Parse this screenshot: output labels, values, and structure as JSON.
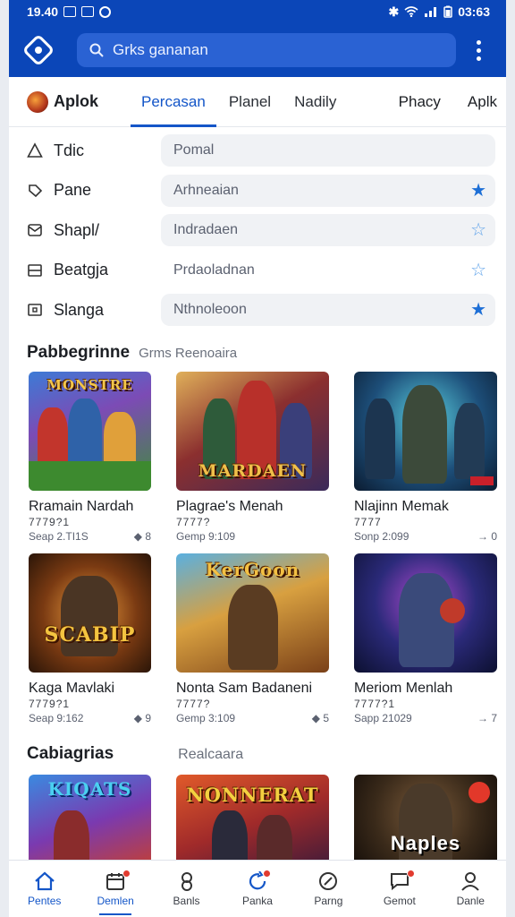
{
  "status": {
    "time": "19.40",
    "right_text": "03:63"
  },
  "search": {
    "placeholder": "Grks gananan"
  },
  "tabs": {
    "brand": "Aplok",
    "items": [
      "Percasan",
      "Planel",
      "Nadily"
    ],
    "right": [
      "Phacy",
      "Aplk"
    ]
  },
  "filters": [
    {
      "label": "Tdic",
      "value": "Pomal",
      "star": "none"
    },
    {
      "label": "Pane",
      "value": "Arhneaian",
      "star": "filled"
    },
    {
      "label": "Shapl/",
      "value": "Indradaen",
      "star": "empty"
    },
    {
      "label": "Beatgja",
      "value": "Prdaoladnan",
      "star": "empty"
    },
    {
      "label": "Slanga",
      "value": "Nthnoleoon",
      "star": "filled"
    }
  ],
  "section1": {
    "title": "Pabbegrinne",
    "subtitle": "Grms Reenoaira"
  },
  "games": [
    {
      "name": "Rramain Nardah",
      "sub": "7779?1",
      "meta": "Seap 2.TI1S",
      "count": "8",
      "art": "MONSTRE"
    },
    {
      "name": "Plagrae's Menah",
      "sub": "7777?",
      "meta": "Gemp 9:109",
      "count": "",
      "art": "MARDAEN"
    },
    {
      "name": "Nlajinn Memak",
      "sub": "7777",
      "meta": "Sonp 2:099",
      "count": "0",
      "art": ""
    },
    {
      "name": "Kaga Mavlaki",
      "sub": "7779?1",
      "meta": "Seap 9:162",
      "count": "9",
      "art": "SCABIP"
    },
    {
      "name": "Nonta Sam Badaneni",
      "sub": "7777?",
      "meta": "Gemp 3:109",
      "count": "5",
      "art": "KerGoon"
    },
    {
      "name": "Meriom Menlah",
      "sub": "7777?1",
      "meta": "Sapp 21029",
      "count": "7",
      "art": ""
    }
  ],
  "section2": {
    "title": "Cabiagrias",
    "subtitle": "Realcaara"
  },
  "games2": [
    {
      "art": "KIQATS"
    },
    {
      "art": "NONNERAT"
    },
    {
      "art": "Naples"
    }
  ],
  "nav": [
    "Pentes",
    "Demlen",
    "Banls",
    "Panka",
    "Parng",
    "Gemot",
    "Danle"
  ],
  "colors": {
    "brand_blue": "#0b46b8",
    "accent": "#1456c8",
    "badge_red": "#e23b2f"
  }
}
